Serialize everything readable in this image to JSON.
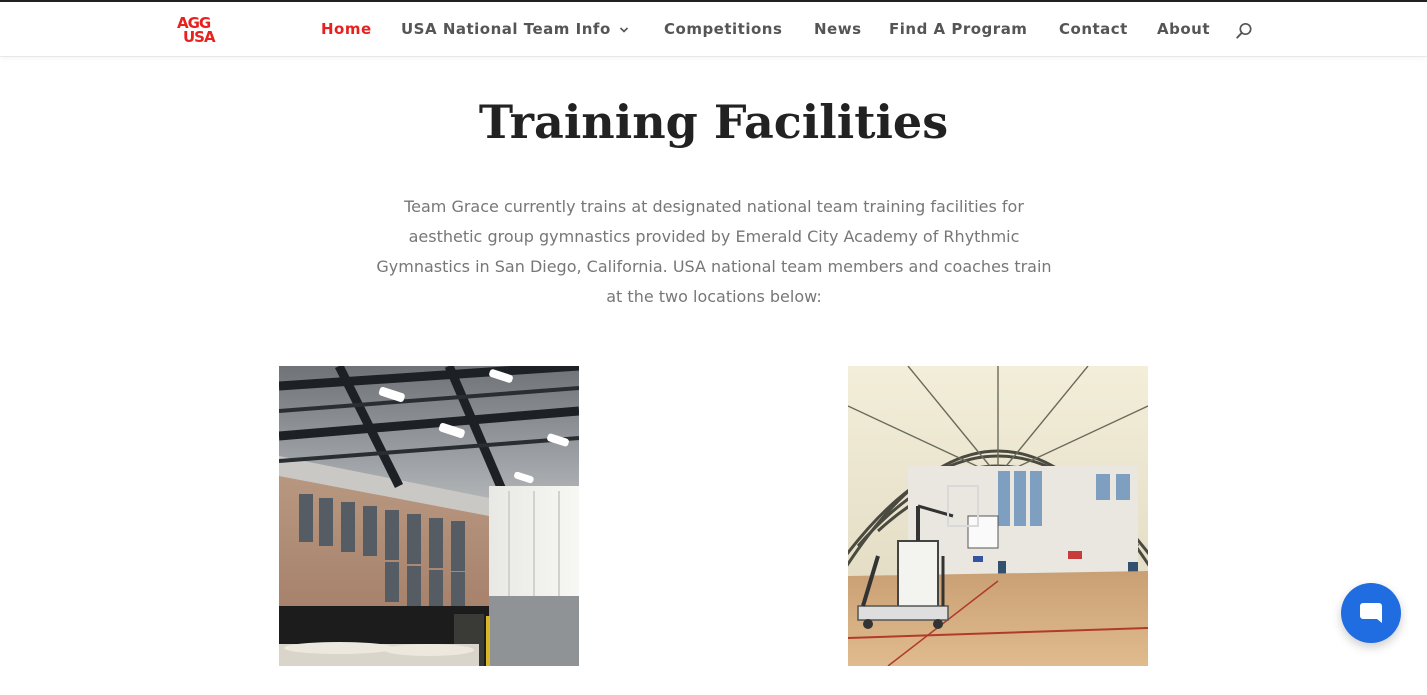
{
  "brand": {
    "logo_line1": "AGG",
    "logo_line2": "USA",
    "color": "#e8211e"
  },
  "nav": {
    "items": [
      {
        "label": "Home",
        "active": true
      },
      {
        "label": "USA National Team Info",
        "has_dropdown": true
      },
      {
        "label": "Competitions"
      },
      {
        "label": "News"
      },
      {
        "label": "Find A Program"
      },
      {
        "label": "Contact"
      },
      {
        "label": "About"
      }
    ]
  },
  "main": {
    "title": "Training Facilities",
    "intro": "Team Grace currently trains at designated national team training facilities for aesthetic group gymnastics provided by Emerald City Academy of Rhythmic Gymnastics in San Diego, California. USA national team members and coaches train at the two locations below:"
  },
  "icons": {
    "search": "search-icon",
    "chevron": "chevron-down-icon",
    "chat": "chat-icon"
  },
  "colors": {
    "accent": "#e8211e",
    "chat": "#1f6de0"
  }
}
